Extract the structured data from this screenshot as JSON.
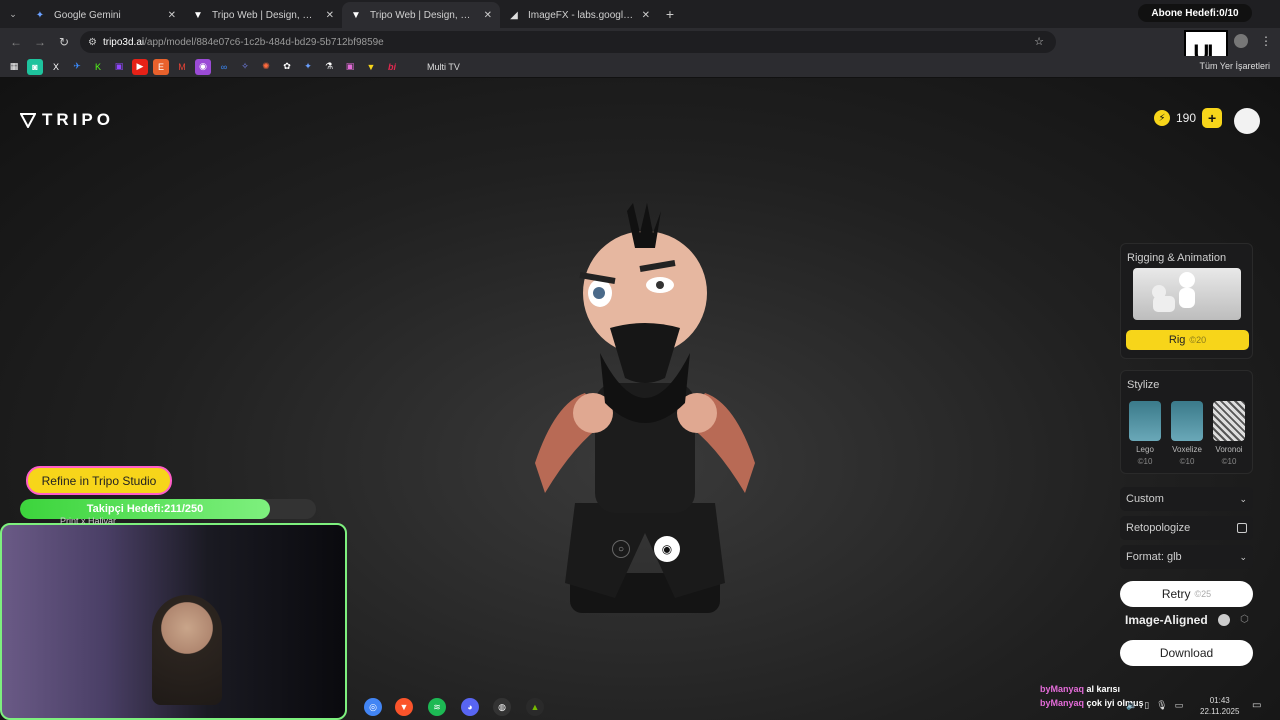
{
  "browser": {
    "tabs": [
      {
        "title": "Google Gemini",
        "icon": "gemini-icon",
        "active": false
      },
      {
        "title": "Tripo Web | Design, Customize,",
        "icon": "tripo-icon",
        "active": false
      },
      {
        "title": "Tripo Web | Design, Customize,",
        "icon": "tripo-icon",
        "active": true
      },
      {
        "title": "ImageFX - labs.google/fx",
        "icon": "imagefx-icon",
        "active": false
      }
    ],
    "new_tab": "+",
    "url_host": "tripo3d.ai",
    "url_path": "/app/model/884e07c6-1c2b-484d-bd29-5b712bf9859e",
    "bookmarks_label": "Multi TV",
    "bookmarks_right": "Tüm Yer İşaretleri",
    "abone": "Abone Hedefi:0/10"
  },
  "app": {
    "brand": "TRIPO",
    "credits": "190",
    "colors": {
      "accent": "#f7d51a",
      "progress": "#3cd43c"
    }
  },
  "panel": {
    "rigging_title": "Rigging & Animation",
    "rig_label": "Rig",
    "rig_cost": "20",
    "stylize_title": "Stylize",
    "styles": [
      {
        "name": "Lego",
        "cost": "10"
      },
      {
        "name": "Voxelize",
        "cost": "10"
      },
      {
        "name": "Voronoi",
        "cost": "10"
      }
    ],
    "custom_label": "Custom",
    "retopologize_label": "Retopologize",
    "format_label": "Format: glb",
    "retry_label": "Retry",
    "retry_cost": "25",
    "aligned_label": "Image-Aligned",
    "download_label": "Download"
  },
  "overlay": {
    "refine_label": "Refine in Tripo Studio",
    "follower_goal": "Takipçi Hedefi:211/250",
    "follower_progress": 0.844,
    "webcam_label": "Print x Halivar",
    "chat": [
      {
        "user": "byManyaq",
        "message": "al karısı"
      },
      {
        "user": "byManyaq",
        "message": "çok iyi olmuş"
      }
    ],
    "time": "01:43",
    "date": "22.11.2025"
  }
}
